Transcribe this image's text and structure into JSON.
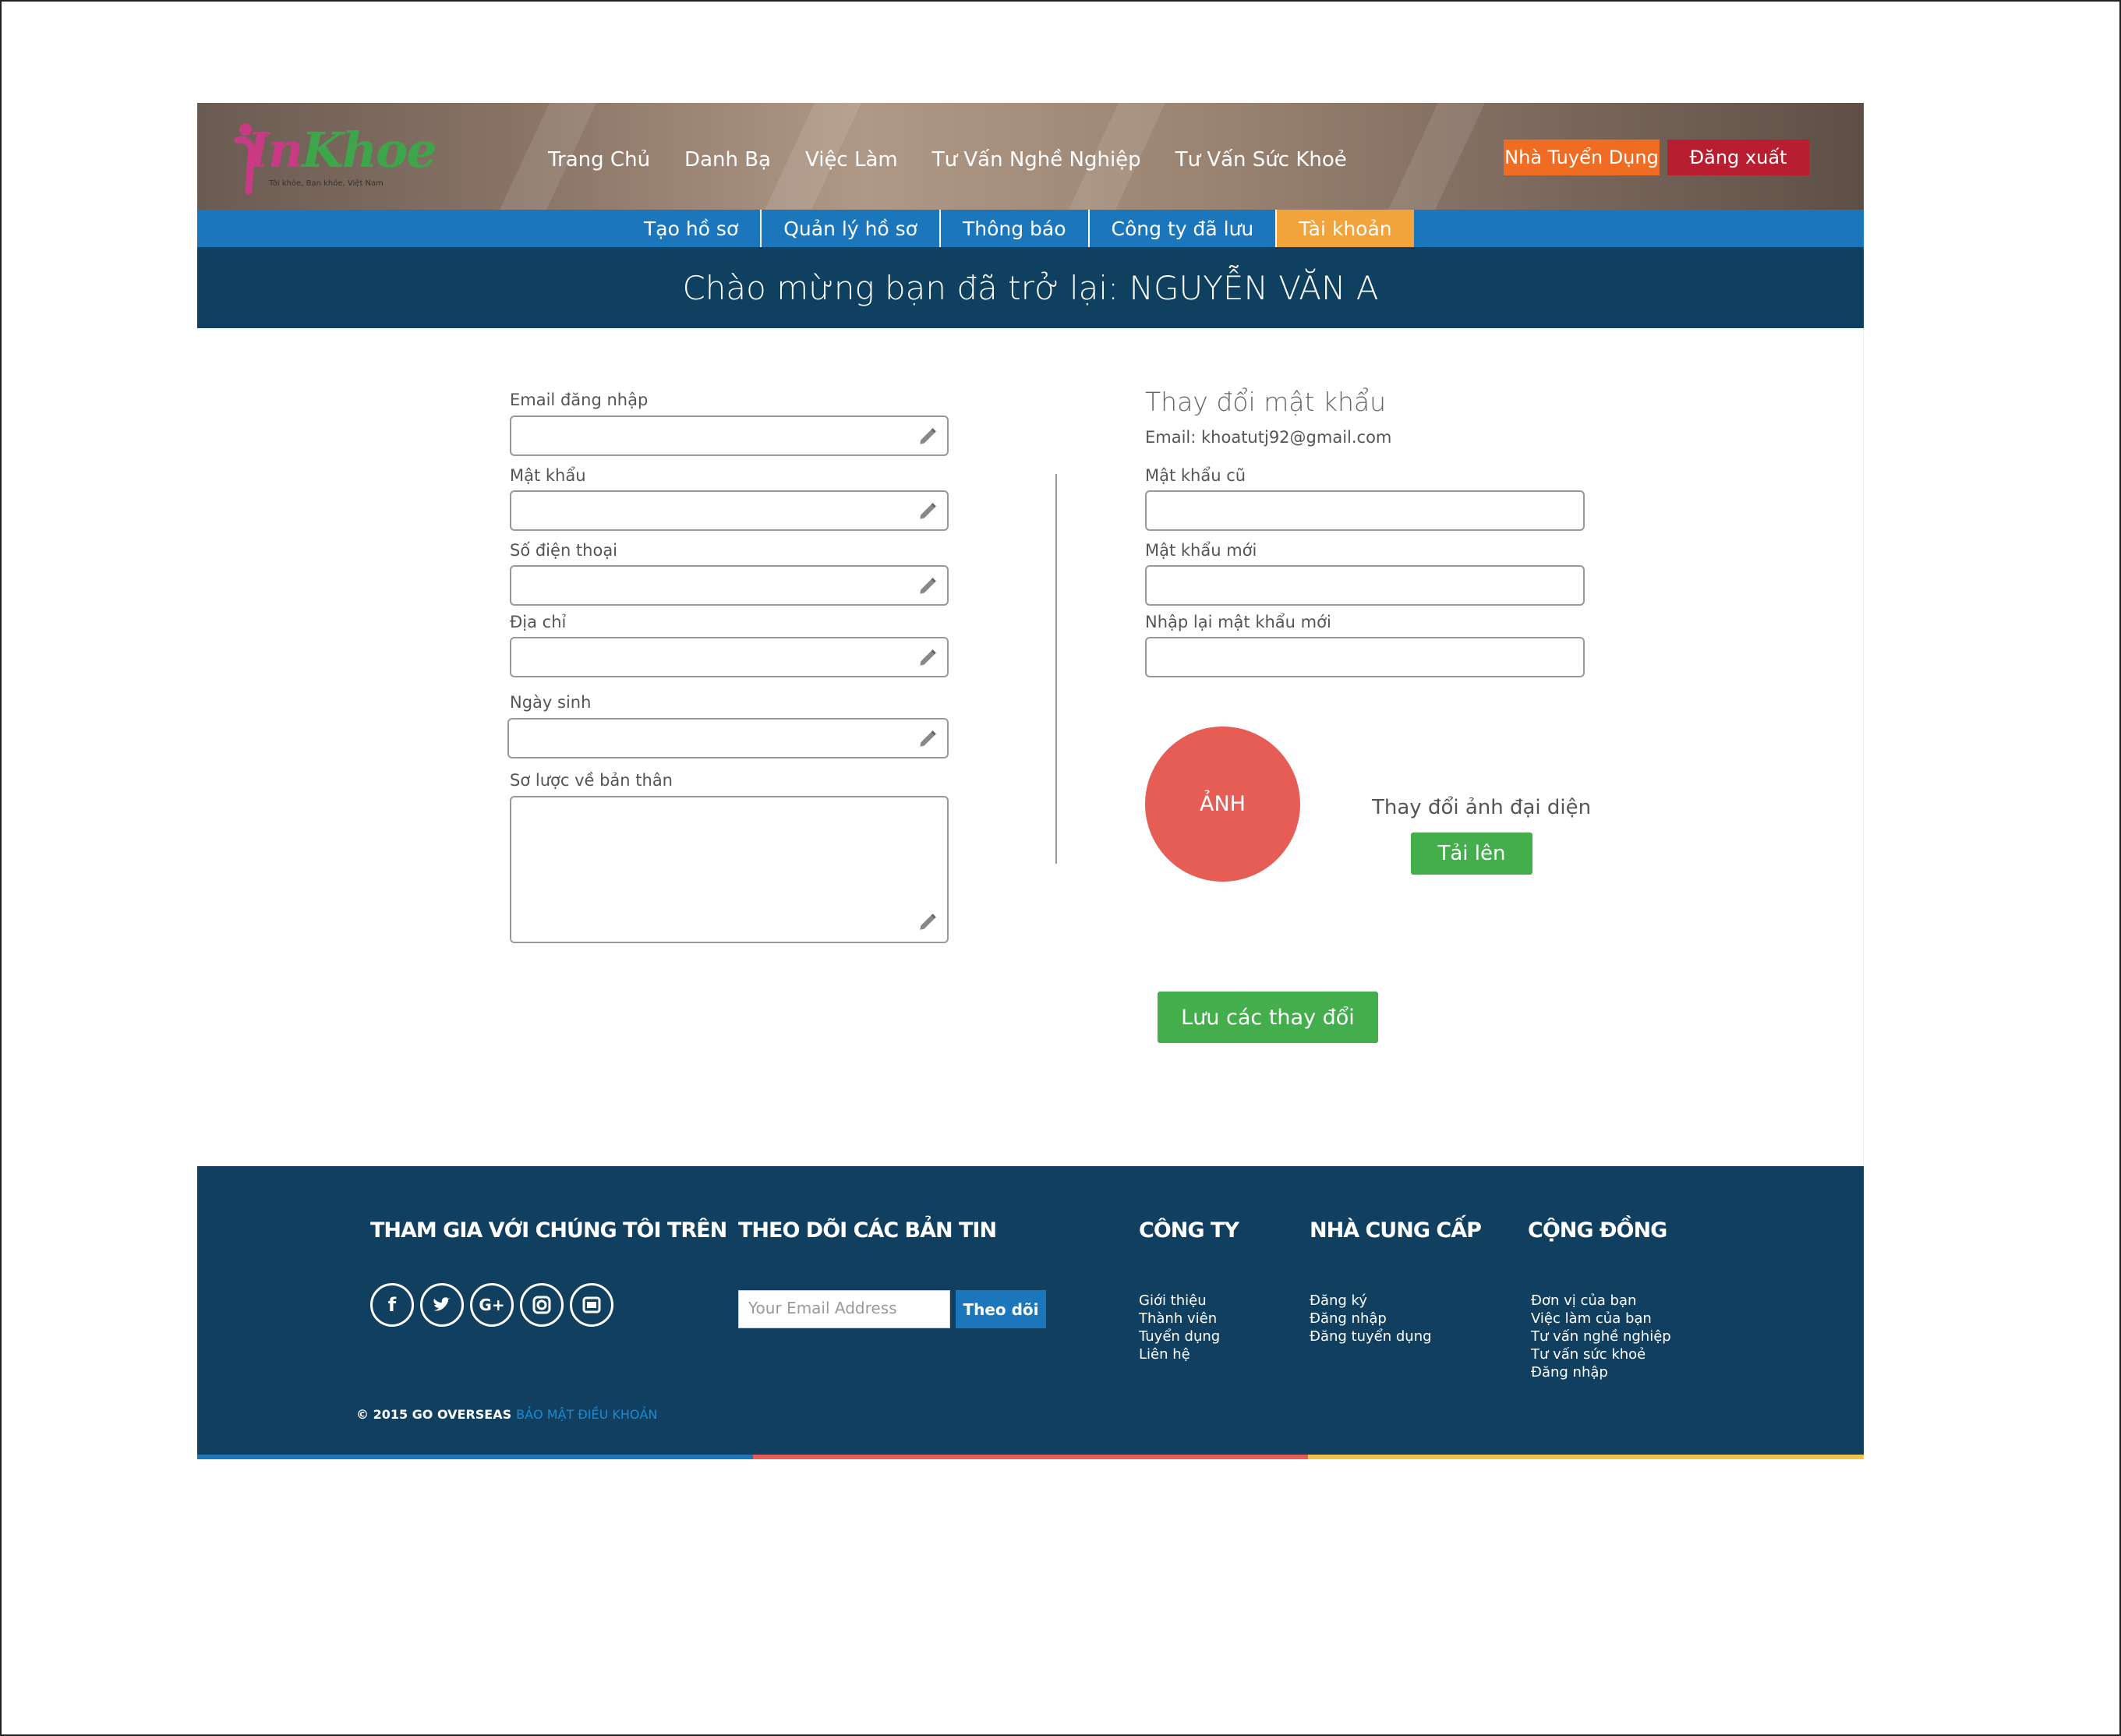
{
  "header": {
    "logo_text_1": "In",
    "logo_text_2": "Khoe",
    "logo_tagline": "Tôi khỏe, Bạn khỏe, Việt Nam",
    "nav": [
      "Trang Chủ",
      "Danh Bạ",
      "Việc Làm",
      "Tư Vấn Nghề Nghiệp",
      "Tư Vấn Sức Khoẻ"
    ],
    "employer_button": "Nhà Tuyển Dụng",
    "logout_button": "Đăng xuất"
  },
  "subnav": {
    "tabs": [
      "Tạo hồ sơ",
      "Quản lý hồ sơ",
      "Thông báo",
      "Công ty đã lưu",
      "Tài khoản"
    ],
    "active": "Tài khoản"
  },
  "welcome": "Chào mừng bạn đã trở lại: NGUYỄN VĂN A",
  "profile_form": {
    "email_label": "Email đăng nhập",
    "password_label": "Mật khẩu",
    "phone_label": "Số điện thoại",
    "address_label": "Địa chỉ",
    "birthday_label": "Ngày sinh",
    "bio_label": "Sơ lược về bản thân"
  },
  "password_form": {
    "title": "Thay đổi mật khẩu",
    "email_info": "Email: khoatutj92@gmail.com",
    "old_label": "Mật khẩu cũ",
    "new_label": "Mật khẩu mới",
    "confirm_label": "Nhập lại mật khẩu mới"
  },
  "avatar": {
    "placeholder": "ẢNH",
    "change_label": "Thay đổi ảnh đại diện",
    "upload_button": "Tải lên"
  },
  "save_button": "Lưu các thay đổi",
  "footer": {
    "join_heading": "THAM GIA VỚI CHÚNG TÔI TRÊN",
    "newsletter_heading": "THEO DÕI CÁC BẢN TIN",
    "company_heading": "CÔNG TY",
    "provider_heading": "NHÀ CUNG CẤP",
    "community_heading": "CỘNG ĐỒNG",
    "social_icons": [
      "facebook-icon",
      "twitter-icon",
      "google-plus-icon",
      "instagram-icon",
      "youtube-icon"
    ],
    "email_placeholder": "Your Email Address",
    "subscribe_button": "Theo dõi",
    "company_links": [
      "Giới thiệu",
      "Thành viên",
      "Tuyển dụng",
      "Liên hệ"
    ],
    "provider_links": [
      "Đăng ký",
      "Đăng nhập",
      "Đăng tuyển dụng"
    ],
    "community_links": [
      "Đơn vị của bạn",
      "Việc làm của bạn",
      "Tư vấn nghề nghiệp",
      "Tư vấn sức khoẻ",
      "Đăng nhập"
    ],
    "copyright": "© 2015 GO OVERSEAS",
    "terms": "BẢO MẬT ĐIỀU KHOẢN"
  },
  "colors": {
    "primary_blue": "#1b76bc",
    "dark_navy": "#0f4060",
    "active_tab": "#f2a33c",
    "orange_button": "#ef6c22",
    "red_button": "#b81e30",
    "green_button": "#44ae4c",
    "avatar_red": "#e65d55",
    "footer_bar": [
      "#1b76bc",
      "#e65d55",
      "#f2c14e"
    ]
  }
}
